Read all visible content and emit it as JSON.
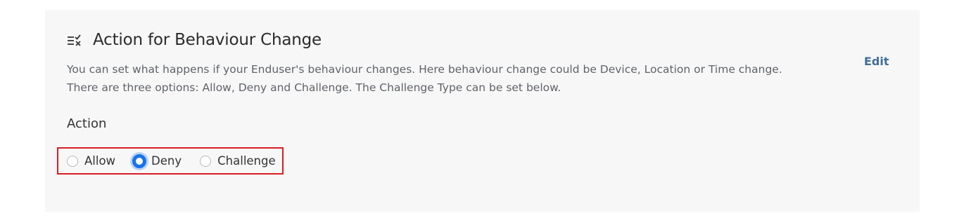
{
  "section": {
    "title": "Action for Behaviour Change",
    "icon": "list-check-icon",
    "description_line1": "You can set what happens if your Enduser's behaviour changes. Here behaviour change could be Device, Location or Time change.",
    "description_line2": "There are three options: Allow, Deny and Challenge. The Challenge Type can be set below.",
    "edit_label": "Edit"
  },
  "action": {
    "label": "Action",
    "options": [
      {
        "label": "Allow",
        "checked": false
      },
      {
        "label": "Deny",
        "checked": true
      },
      {
        "label": "Challenge",
        "checked": false
      }
    ],
    "selected": "Deny"
  },
  "colors": {
    "accent": "#1a73e8",
    "highlight_border": "#d81e25",
    "edit_link": "#3f6f99",
    "card_background": "#f7f7f7"
  }
}
